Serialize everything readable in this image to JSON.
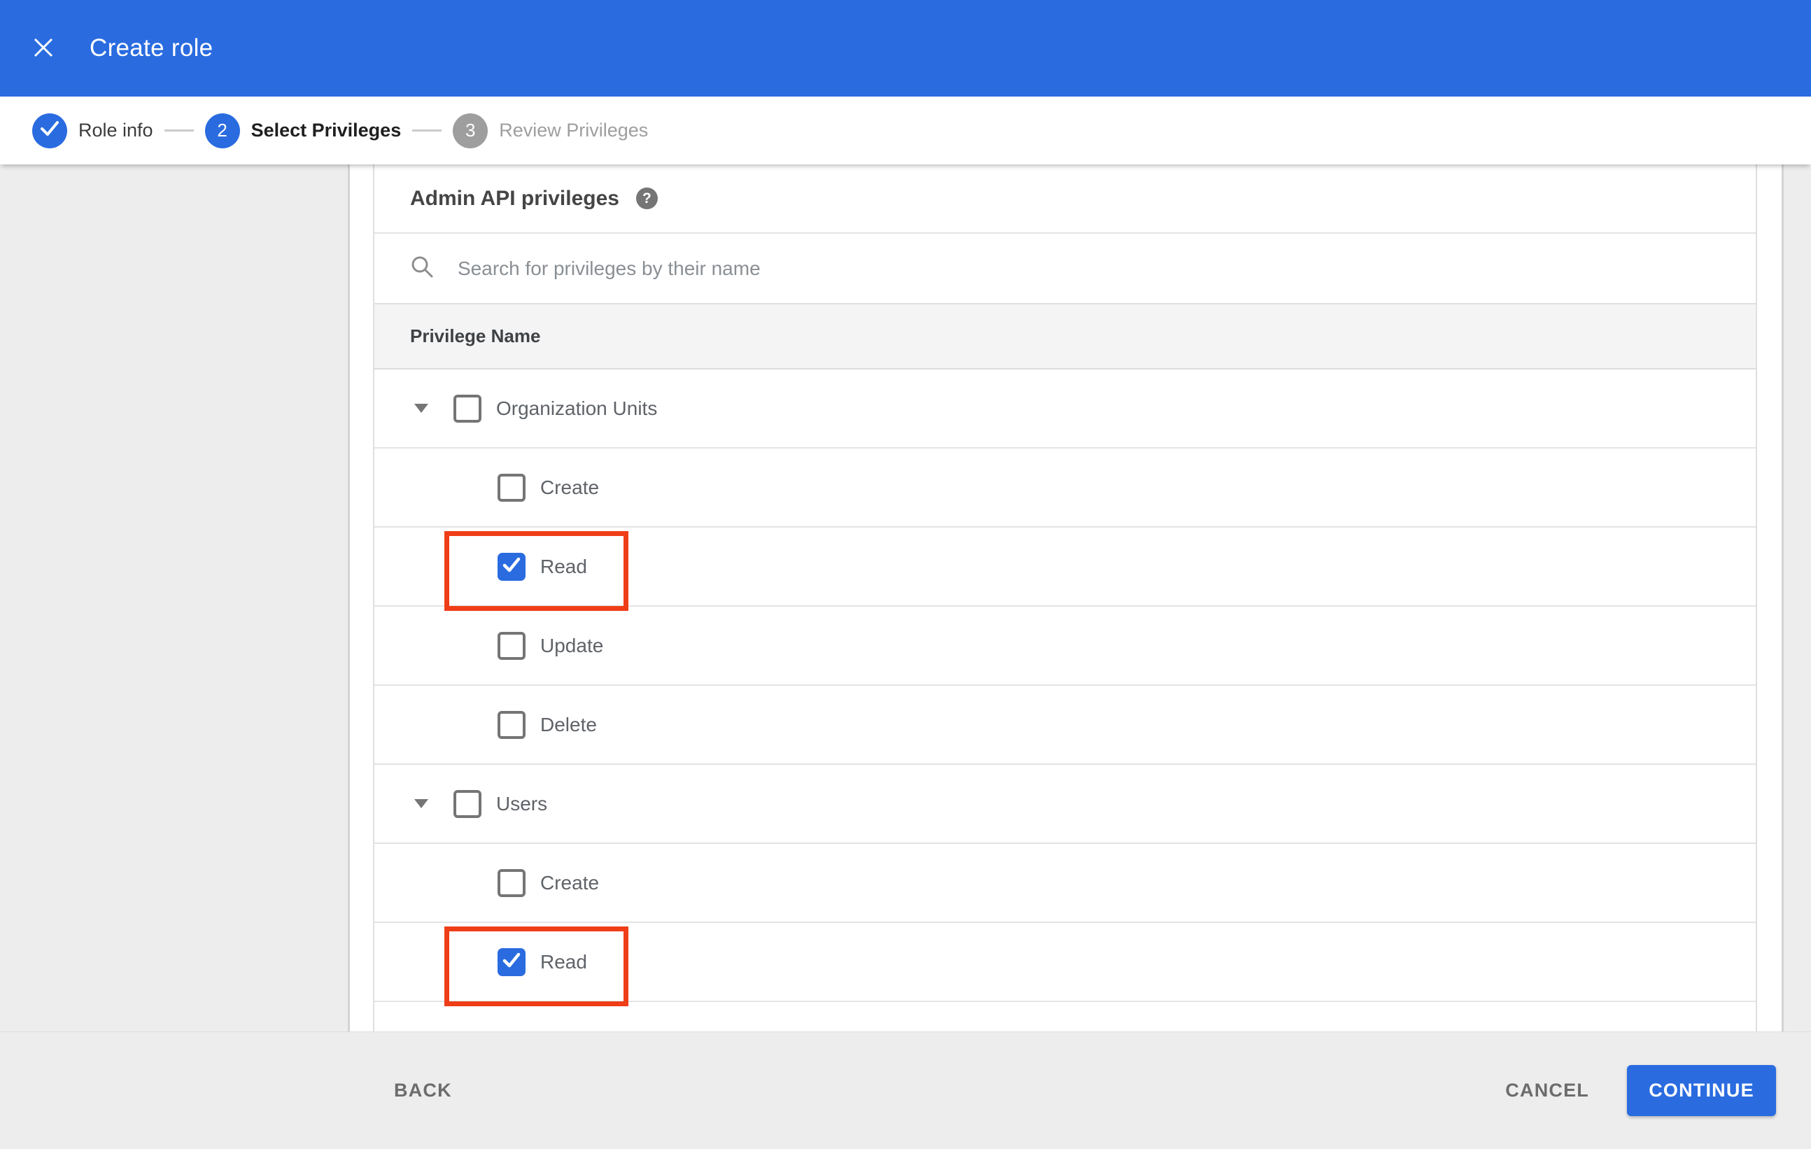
{
  "header": {
    "title": "Create role"
  },
  "stepper": {
    "steps": [
      {
        "label": "Role info",
        "state": "done"
      },
      {
        "number": "2",
        "label": "Select Privileges",
        "state": "active"
      },
      {
        "number": "3",
        "label": "Review Privileges",
        "state": "inactive"
      }
    ]
  },
  "privileges": {
    "heading": "Admin API privileges",
    "search_placeholder": "Search for privileges by their name",
    "column_header": "Privilege Name",
    "rows": [
      {
        "label": "Organization Units",
        "level": 0,
        "expanded": true,
        "checked": false,
        "annotated": false
      },
      {
        "label": "Create",
        "level": 1,
        "checked": false,
        "annotated": false
      },
      {
        "label": "Read",
        "level": 1,
        "checked": true,
        "annotated": true
      },
      {
        "label": "Update",
        "level": 1,
        "checked": false,
        "annotated": false
      },
      {
        "label": "Delete",
        "level": 1,
        "checked": false,
        "annotated": false
      },
      {
        "label": "Users",
        "level": 0,
        "expanded": true,
        "checked": false,
        "annotated": false
      },
      {
        "label": "Create",
        "level": 1,
        "checked": false,
        "annotated": false
      },
      {
        "label": "Read",
        "level": 1,
        "checked": true,
        "annotated": true
      }
    ]
  },
  "footer": {
    "back": "BACK",
    "cancel": "CANCEL",
    "continue": "CONTINUE"
  },
  "colors": {
    "accent": "#2a6ce0",
    "annotation": "#ef3e17",
    "step-inactive": "#9e9e9e",
    "chrome-gray": "#ededed"
  }
}
